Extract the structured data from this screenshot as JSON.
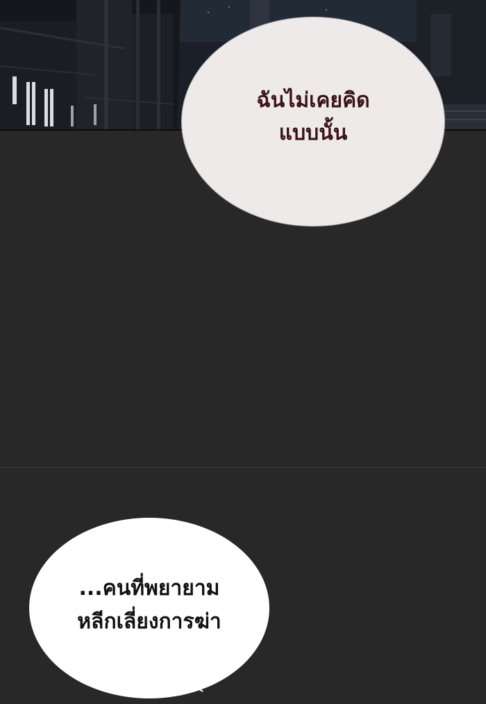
{
  "panels": {
    "top_scene": "night-street-buildings",
    "colors": {
      "gutter": "#282828",
      "bubble_top_text": "#3a1214",
      "bubble_bottom_text": "#111111"
    }
  },
  "bubbles": [
    {
      "lines": [
        "ฉันไม่เคยคิด",
        "แบบนั้น"
      ]
    },
    {
      "lines": [
        "...คนที่พยายาม",
        "หลีกเลี่ยงการฆ่า"
      ]
    }
  ]
}
